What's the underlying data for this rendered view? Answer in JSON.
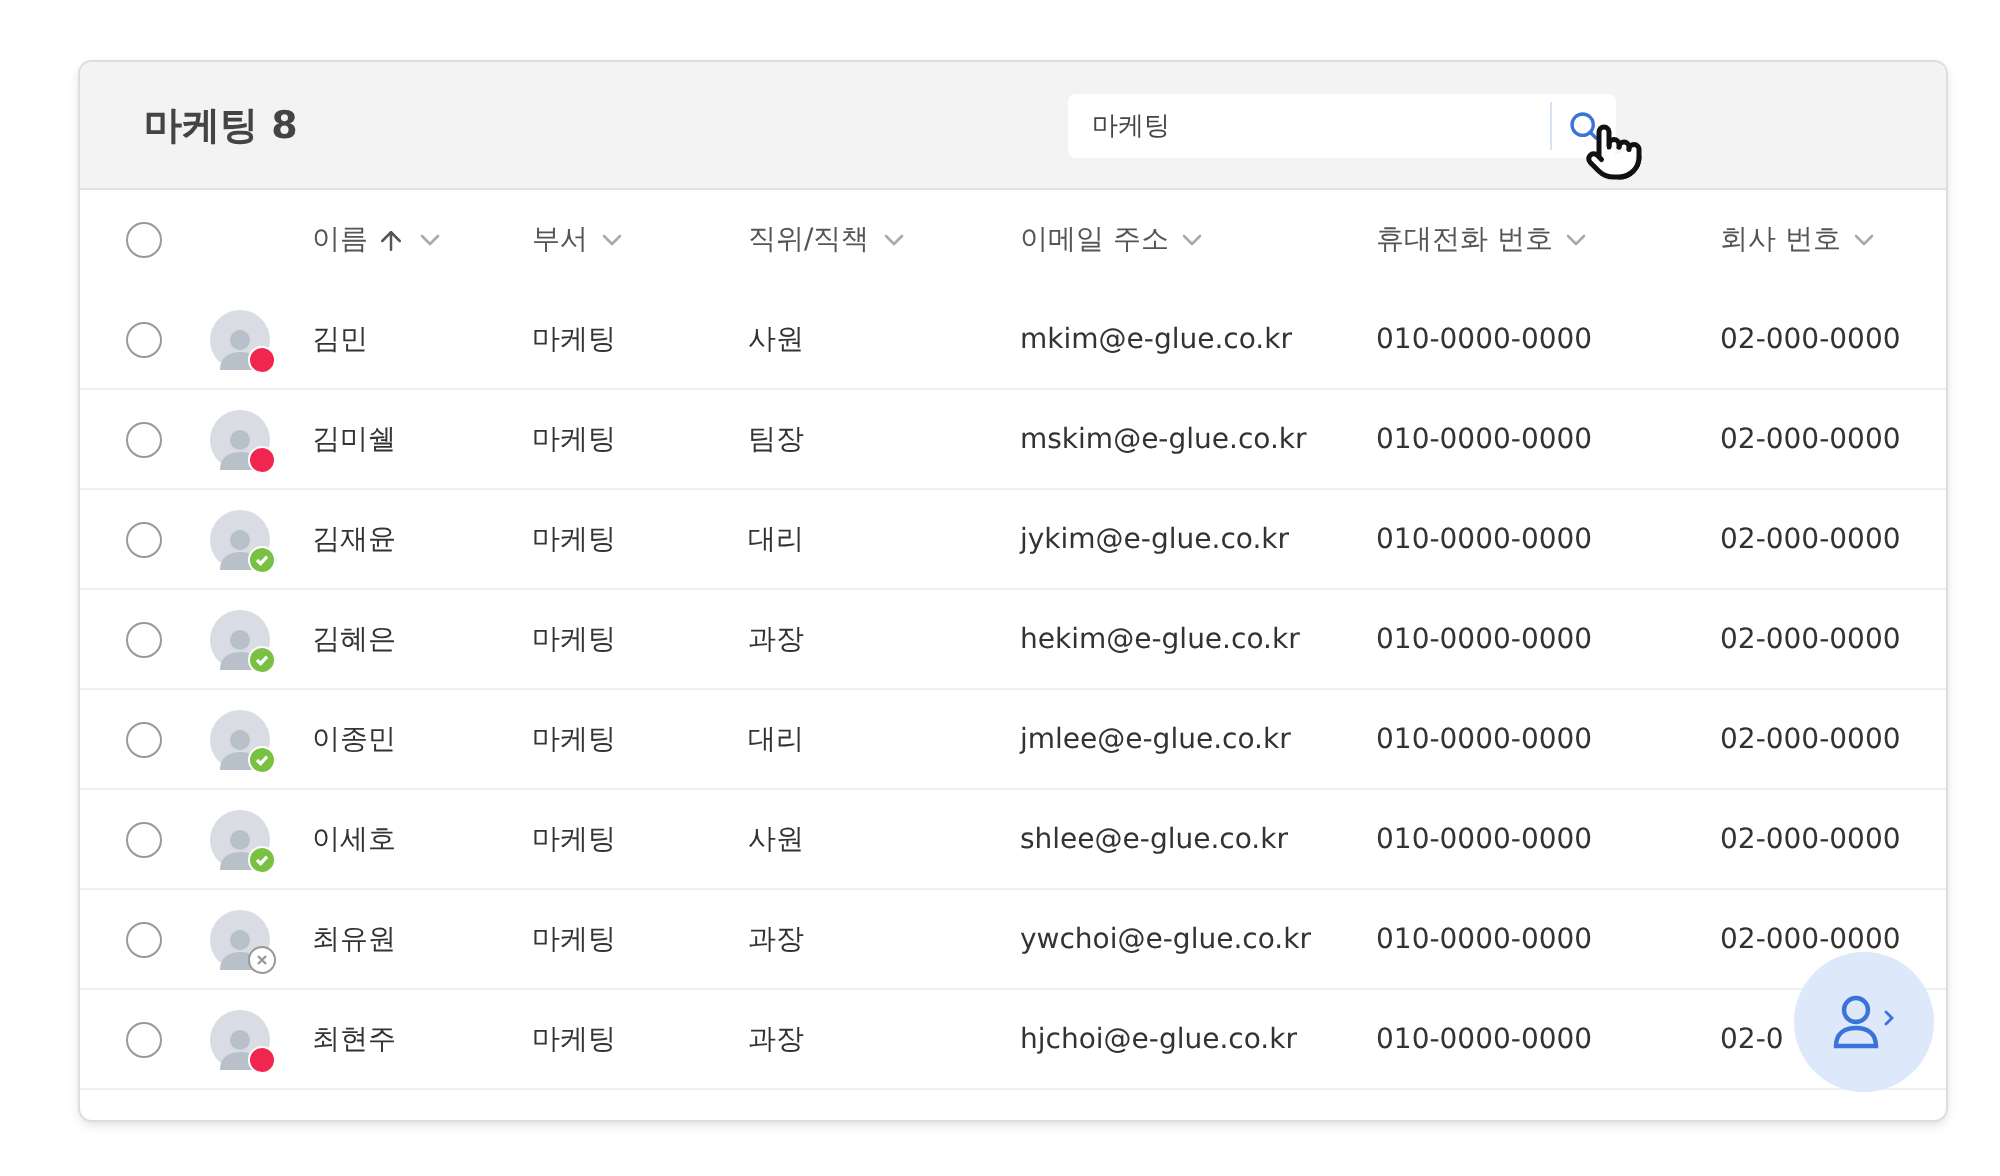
{
  "header": {
    "title": "마케팅 8"
  },
  "search": {
    "value": "마케팅"
  },
  "table": {
    "columns": [
      {
        "label": "이름",
        "sorted": true
      },
      {
        "label": "부서",
        "sorted": false
      },
      {
        "label": "직위/직책",
        "sorted": false
      },
      {
        "label": "이메일 주소",
        "sorted": false
      },
      {
        "label": "휴대전화 번호",
        "sorted": false
      },
      {
        "label": "회사 번호",
        "sorted": false
      }
    ],
    "select_all": {
      "checked": false
    },
    "rows": [
      {
        "checked": false,
        "presence": {
          "kind": "dot",
          "color": "#f0264e"
        },
        "name": "김민",
        "department": "마케팅",
        "position": "사원",
        "email": "mkim@e-glue.co.kr",
        "mobile": "010-0000-0000",
        "company_phone": "02-000-0000"
      },
      {
        "checked": false,
        "presence": {
          "kind": "dot",
          "color": "#f0264e"
        },
        "name": "김미쉘",
        "department": "마케팅",
        "position": "팀장",
        "email": "mskim@e-glue.co.kr",
        "mobile": "010-0000-0000",
        "company_phone": "02-000-0000"
      },
      {
        "checked": false,
        "presence": {
          "kind": "check",
          "color": "#7ac143"
        },
        "name": "김재윤",
        "department": "마케팅",
        "position": "대리",
        "email": "jykim@e-glue.co.kr",
        "mobile": "010-0000-0000",
        "company_phone": "02-000-0000"
      },
      {
        "checked": false,
        "presence": {
          "kind": "check",
          "color": "#7ac143"
        },
        "name": "김혜은",
        "department": "마케팅",
        "position": "과장",
        "email": "hekim@e-glue.co.kr",
        "mobile": "010-0000-0000",
        "company_phone": "02-000-0000"
      },
      {
        "checked": false,
        "presence": {
          "kind": "check",
          "color": "#7ac143"
        },
        "name": "이종민",
        "department": "마케팅",
        "position": "대리",
        "email": "jmlee@e-glue.co.kr",
        "mobile": "010-0000-0000",
        "company_phone": "02-000-0000"
      },
      {
        "checked": false,
        "presence": {
          "kind": "check",
          "color": "#7ac143"
        },
        "name": "이세호",
        "department": "마케팅",
        "position": "사원",
        "email": "shlee@e-glue.co.kr",
        "mobile": "010-0000-0000",
        "company_phone": "02-000-0000"
      },
      {
        "checked": false,
        "presence": {
          "kind": "cross",
          "color": "#999999"
        },
        "name": "최유원",
        "department": "마케팅",
        "position": "과장",
        "email": "ywchoi@e-glue.co.kr",
        "mobile": "010-0000-0000",
        "company_phone": "02-000-0000"
      },
      {
        "checked": false,
        "presence": {
          "kind": "dot",
          "color": "#f0264e"
        },
        "name": "최현주",
        "department": "마케팅",
        "position": "과장",
        "email": "hjchoi@e-glue.co.kr",
        "mobile": "010-0000-0000",
        "company_phone": "02-0"
      }
    ]
  }
}
